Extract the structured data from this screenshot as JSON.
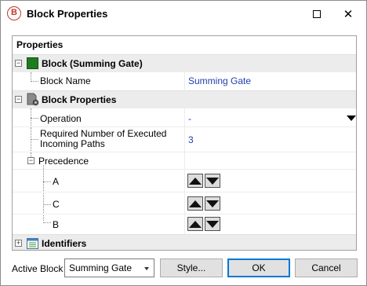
{
  "window": {
    "title": "Block Properties",
    "icon_letter": "B",
    "maximize_icon": "maximize-icon",
    "close_glyph": "✕"
  },
  "properties": {
    "header": "Properties",
    "categories": {
      "block": {
        "label": "Block (Summing Gate)",
        "expander": "−",
        "icon": "green-block-icon",
        "icon_color": "#1e7b1e"
      },
      "block_properties": {
        "label": "Block Properties",
        "expander": "−",
        "icon": "page-gear-icon"
      },
      "identifiers": {
        "label": "Identifiers",
        "expander": "+",
        "icon": "calendar-list-icon"
      }
    },
    "block_name": {
      "name": "Block Name",
      "value": "Summing Gate"
    },
    "operation": {
      "name": "Operation",
      "value": "-",
      "dropdown_icon": "dropdown-arrow-icon"
    },
    "required_paths": {
      "name_line1": "Required Number of Executed",
      "name_line2": "Incoming Paths",
      "value": "3"
    },
    "precedence": {
      "name": "Precedence",
      "expander": "−",
      "items": [
        {
          "name": "A"
        },
        {
          "name": "C"
        },
        {
          "name": "B"
        }
      ]
    }
  },
  "footer": {
    "active_block_label": "Active Block",
    "active_block_value": "Summing Gate",
    "style_button": "Style...",
    "ok_button": "OK",
    "cancel_button": "Cancel"
  }
}
